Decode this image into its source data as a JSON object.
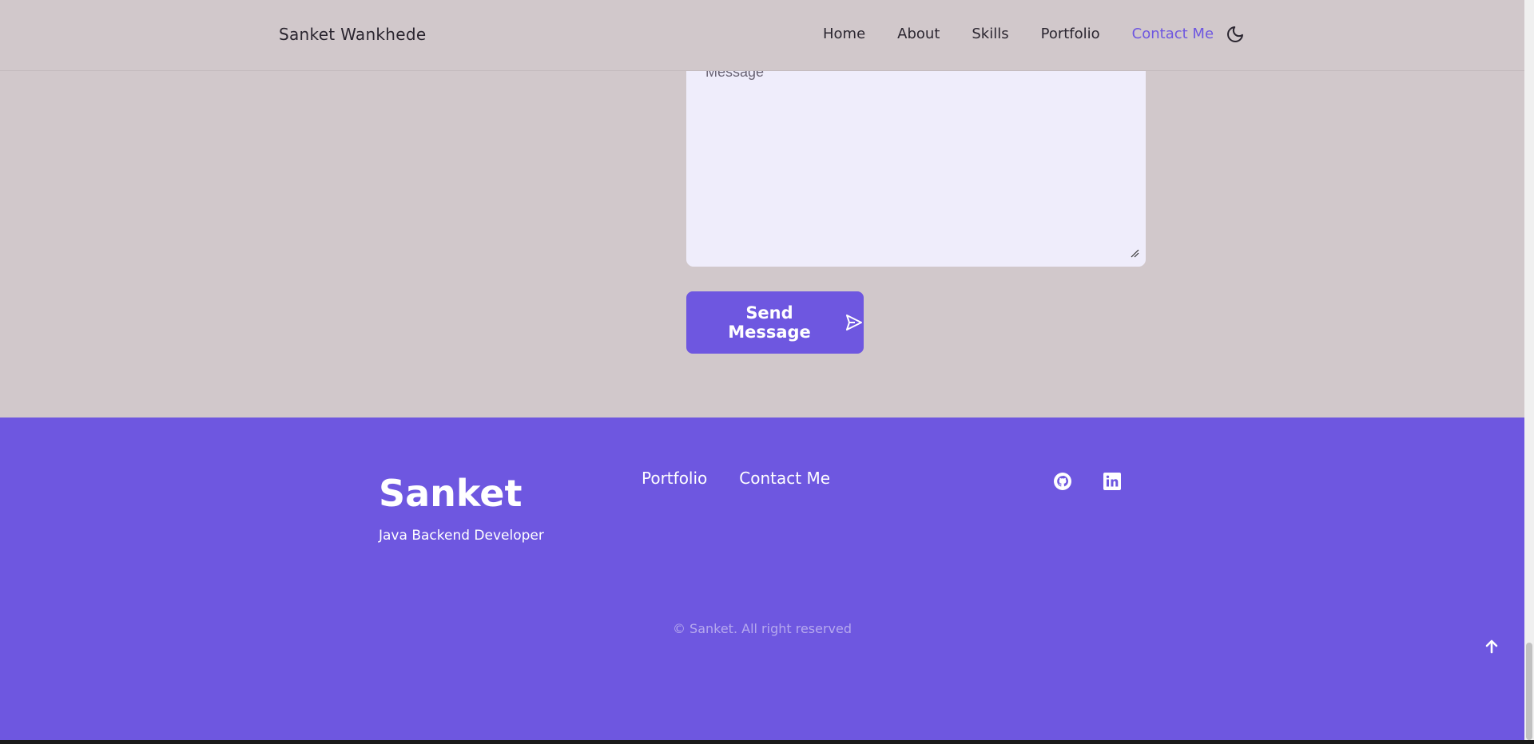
{
  "header": {
    "brand": "Sanket Wankhede",
    "nav": [
      {
        "label": "Home"
      },
      {
        "label": "About"
      },
      {
        "label": "Skills"
      },
      {
        "label": "Portfolio"
      },
      {
        "label": "Contact Me",
        "active": true
      }
    ],
    "theme_icon": "moon-icon"
  },
  "contact": {
    "message_placeholder": "Message",
    "send_label": "Send Message",
    "send_icon": "send-icon"
  },
  "footer": {
    "title": "Sanket",
    "subtitle": "Java Backend Developer",
    "links": [
      {
        "label": "Portfolio"
      },
      {
        "label": "Contact Me"
      }
    ],
    "social": [
      "github-icon",
      "linkedin-icon"
    ],
    "copyright": "© Sanket. All right reserved"
  },
  "colors": {
    "accent": "#6e57e0",
    "background": "#d1c8cb",
    "textarea_bg": "#efedfb"
  }
}
